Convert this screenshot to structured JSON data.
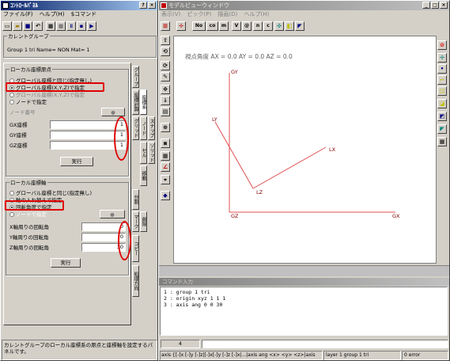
{
  "left": {
    "title": "ｺﾝﾄﾛｰﾙﾊﾟﾈﾙ",
    "menu": [
      "ファイル(F)",
      "ヘルプ(H)",
      "$コマンド"
    ],
    "current_group_label": "カレントグループ",
    "current_group_value": "Group 1 tri Name= NON Mat= 1",
    "origin_group_title": "ローカル座標原点",
    "origin_options": [
      "グローバル座標と同じ(指定無し)",
      "グローバル座標(X,Y,Z)で指定",
      "グローバル座標(X,Y,Z)で指定",
      "ノードで指定"
    ],
    "node_label": "ノード番号",
    "gx_label": "GX座標",
    "gx_value": "1",
    "gy_label": "GY座標",
    "gy_value": "1",
    "gz_label": "GZ座標",
    "gz_value": "1",
    "exec_label": "実行",
    "axis_group_title": "ローカル座標軸",
    "axis_options": [
      "グローバル座標と同じ(指定無し)",
      "軸の入れ替えで指定",
      "回転角度で指定",
      "ノードで指定"
    ],
    "x_rot_label": "X軸周りの回転角",
    "x_rot_value": "0",
    "y_rot_label": "Y軸周りの回転角",
    "y_rot_value": "0",
    "z_rot_label": "Z軸周りの回転角",
    "z_rot_value": "30",
    "exec2_label": "実行",
    "tabs": [
      "グループ",
      "座標計算",
      "座標系",
      "グリッド",
      "ノード",
      "スナップ",
      "セル",
      "ソリッド",
      "移動",
      "分割",
      "マーク",
      "削除",
      "コピー",
      "処理方向"
    ],
    "status": "カレントグループのローカル座標系の原点と座標軸を設定するパネルです。"
  },
  "right": {
    "title": "モデルビューウィンドウ",
    "menu": [
      "表示(V)",
      "ピック(P)",
      "描画(D)",
      "ヘルプ(H)"
    ],
    "toolbar_labels": [
      "No",
      "co",
      "m",
      "V",
      "@",
      "n",
      "c"
    ],
    "view_info": "視点角度 AX = 0.0 AY = 0.0 AZ = 0.0",
    "axes": {
      "GY": "GY",
      "GZ": "GZ",
      "GX": "GX",
      "LY": "LY",
      "LX": "LX",
      "LZ": "LZ"
    },
    "cmd_title": "コマンド入力",
    "cmd_lines": [
      "1 : group 1 tri",
      "2 : origin xyz 1 1 1",
      "3 : axis ang 0 0 30"
    ],
    "cmd_number": "4",
    "status_hint": "axis {[-]x [-]y [-]z|[-]x[-]y [-]z [-]x|...|axis ang <x> <y> <z>|axis",
    "status_layer": "layer 1 group 1 tri",
    "status_error": "0 error",
    "colors": {
      "axis_red": "#e05050",
      "axis_label": "#800000",
      "title_blue": "#0a246a",
      "highlight": "#e00000"
    }
  }
}
